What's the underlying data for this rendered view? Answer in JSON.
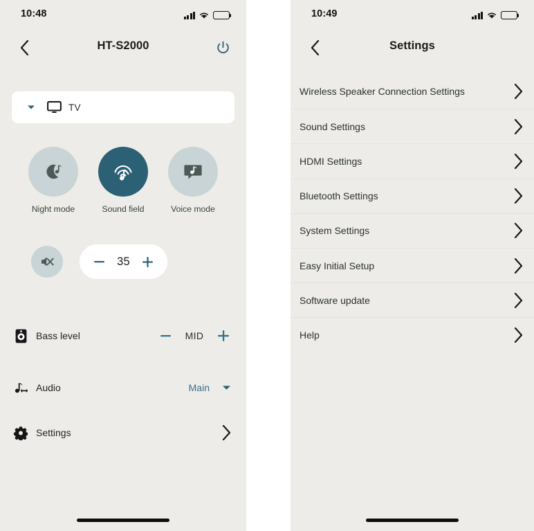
{
  "left_phone": {
    "status": {
      "time": "10:48",
      "signal_icon": "cellular-signal-icon",
      "wifi_icon": "wifi-icon",
      "battery_icon": "battery-icon"
    },
    "nav": {
      "back_icon": "chevron-left-icon",
      "title": "HT-S2000",
      "power_icon": "power-icon"
    },
    "source": {
      "caret_icon": "caret-down-icon",
      "device_icon": "tv-icon",
      "label": "TV"
    },
    "modes": [
      {
        "icon": "moon-music-icon",
        "label": "Night mode",
        "active": false
      },
      {
        "icon": "sound-field-icon",
        "label": "Sound field",
        "active": true
      },
      {
        "icon": "voice-bubble-icon",
        "label": "Voice mode",
        "active": false
      }
    ],
    "volume": {
      "mute_icon": "speaker-mute-icon",
      "minus_label": "−",
      "value": "35",
      "plus_label": "+"
    },
    "bass": {
      "icon": "subwoofer-icon",
      "label": "Bass level",
      "minus_label": "−",
      "value": "MID",
      "plus_label": "+"
    },
    "audio": {
      "icon": "audio-note-icon",
      "label": "Audio",
      "value": "Main",
      "caret_icon": "caret-down-icon"
    },
    "settings": {
      "icon": "gear-icon",
      "label": "Settings",
      "chevron_icon": "chevron-right-icon"
    }
  },
  "right_phone": {
    "status": {
      "time": "10:49",
      "signal_icon": "cellular-signal-icon",
      "wifi_icon": "wifi-icon",
      "battery_icon": "battery-icon"
    },
    "nav": {
      "back_icon": "chevron-left-icon",
      "title": "Settings"
    },
    "items": [
      {
        "label": "Wireless Speaker Connection Settings",
        "chevron_icon": "chevron-right-icon"
      },
      {
        "label": "Sound Settings",
        "chevron_icon": "chevron-right-icon"
      },
      {
        "label": "HDMI Settings",
        "chevron_icon": "chevron-right-icon"
      },
      {
        "label": "Bluetooth Settings",
        "chevron_icon": "chevron-right-icon"
      },
      {
        "label": "System Settings",
        "chevron_icon": "chevron-right-icon"
      },
      {
        "label": "Easy Initial Setup",
        "chevron_icon": "chevron-right-icon"
      },
      {
        "label": "Software update",
        "chevron_icon": "chevron-right-icon"
      },
      {
        "label": "Help",
        "chevron_icon": "chevron-right-icon"
      }
    ]
  },
  "colors": {
    "screen_bg": "#edece8",
    "card_bg": "#ffffff",
    "accent_teal": "#2b6075",
    "accent_teal_light": "#35718a",
    "chip_inactive": "#c8d4d6",
    "text_primary": "#1b1b1b",
    "divider": "#e2e1dc"
  }
}
